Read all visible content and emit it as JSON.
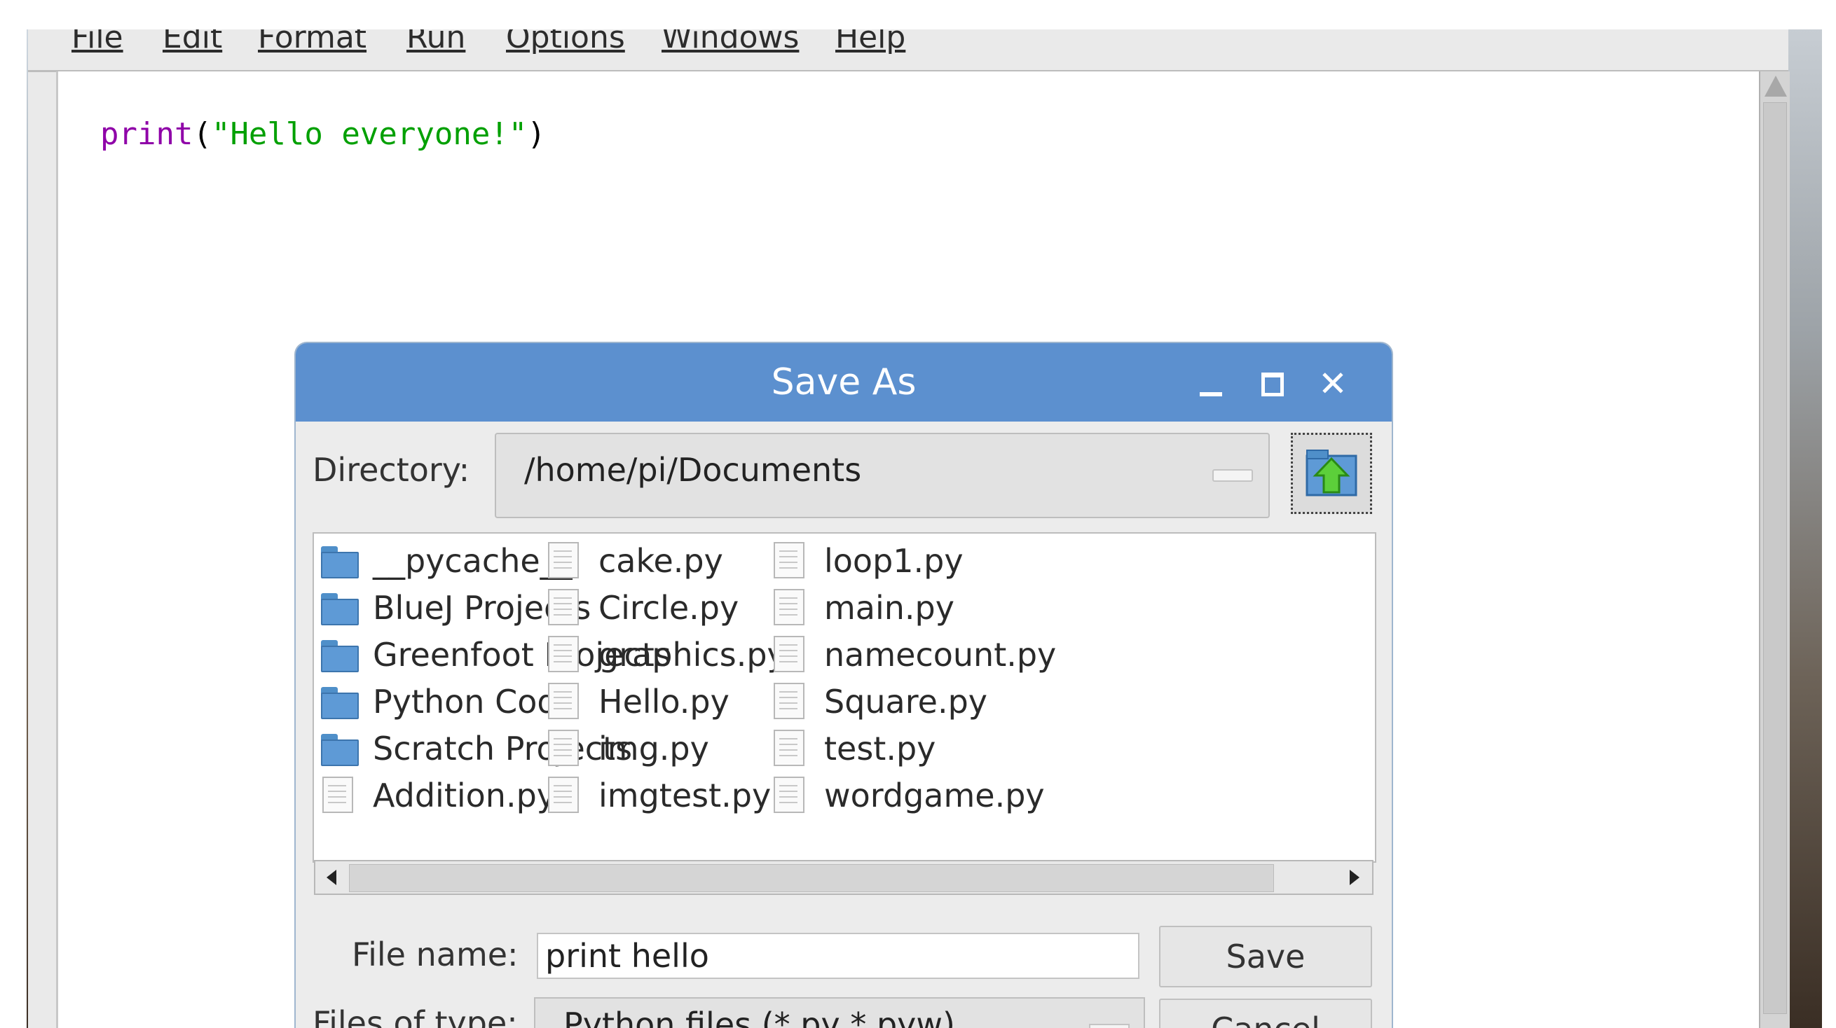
{
  "menubar": {
    "items": [
      "File",
      "Edit",
      "Format",
      "Run",
      "Options",
      "Windows",
      "Help"
    ]
  },
  "editor": {
    "code": {
      "func": "print",
      "open": "(",
      "string": "\"Hello everyone!\"",
      "close": ")"
    },
    "colors": {
      "keyword": "#8f00a8",
      "string": "#00a000"
    }
  },
  "dialog": {
    "title": "Save As",
    "titlebar_color": "#5c90cf",
    "window_controls": [
      "minimize-icon",
      "maximize-icon",
      "close-icon"
    ],
    "close_glyph": "✕",
    "directory_label": "Directory:",
    "directory_value": "/home/pi/Documents",
    "up_folder_icon": "folder-up-icon",
    "files": {
      "col1": [
        {
          "name": "__pycache__",
          "type": "folder"
        },
        {
          "name": "BlueJ Projects",
          "type": "folder"
        },
        {
          "name": "Greenfoot Projects",
          "type": "folder"
        },
        {
          "name": "Python Code",
          "type": "folder"
        },
        {
          "name": "Scratch Projects",
          "type": "folder"
        },
        {
          "name": "Addition.py",
          "type": "file"
        }
      ],
      "col2": [
        {
          "name": "cake.py",
          "type": "file"
        },
        {
          "name": "Circle.py",
          "type": "file"
        },
        {
          "name": "graphics.py",
          "type": "file"
        },
        {
          "name": "Hello.py",
          "type": "file"
        },
        {
          "name": "img.py",
          "type": "file"
        },
        {
          "name": "imgtest.py",
          "type": "file"
        }
      ],
      "col3": [
        {
          "name": "loop1.py",
          "type": "file"
        },
        {
          "name": "main.py",
          "type": "file"
        },
        {
          "name": "namecount.py",
          "type": "file"
        },
        {
          "name": "Square.py",
          "type": "file"
        },
        {
          "name": "test.py",
          "type": "file"
        },
        {
          "name": "wordgame.py",
          "type": "file"
        }
      ]
    },
    "filename_label": "File name:",
    "filename_value": "print hello",
    "filetype_label": "Files of type:",
    "filetype_value": "Python files (*.py *.pyw)",
    "save_label": "Save",
    "cancel_label": "Cancel"
  }
}
